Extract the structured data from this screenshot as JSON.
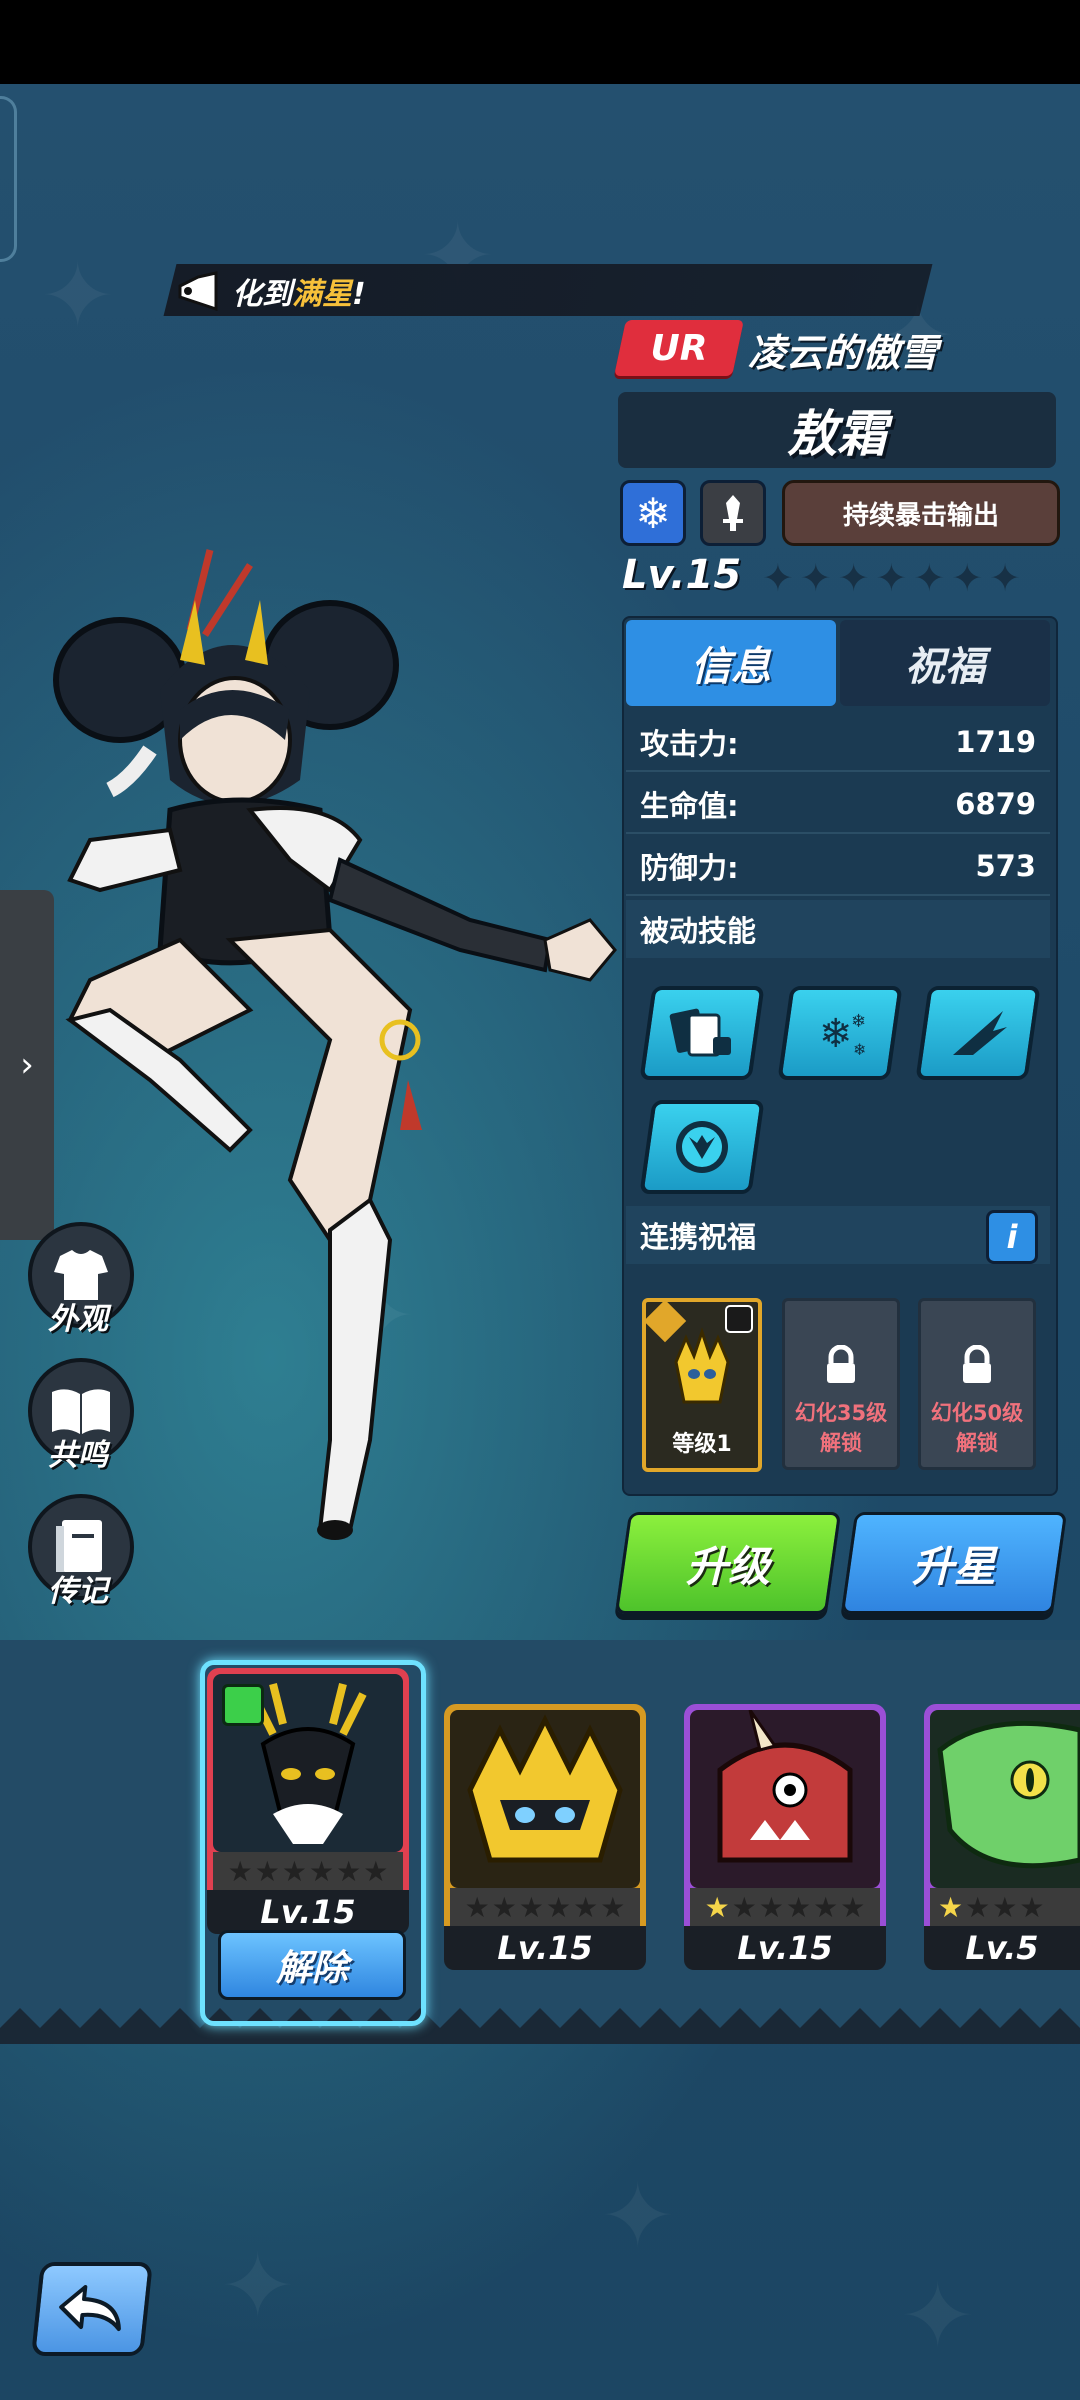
{
  "announcement": {
    "prefix": "化到",
    "highlight": "满星",
    "suffix": "!"
  },
  "character": {
    "rarity": "UR",
    "title": "凌云的傲雪",
    "name": "敖霜",
    "element_icon": "snowflake-icon",
    "role_icon": "sword-icon",
    "role_tag": "持续暴击输出",
    "level": "Lv.15",
    "stars": 0,
    "max_stars": 7
  },
  "tabs": [
    {
      "label": "信息",
      "active": true
    },
    {
      "label": "祝福",
      "active": false
    }
  ],
  "stats": [
    {
      "label": "攻击力:",
      "value": "1719"
    },
    {
      "label": "生命值:",
      "value": "6879"
    },
    {
      "label": "防御力:",
      "value": "573"
    }
  ],
  "passive": {
    "title": "被动技能",
    "skills": [
      "cards-dice-icon",
      "snowflakes-icon",
      "wing-icon",
      "dragon-emblem-icon"
    ]
  },
  "bond": {
    "title": "连携祝福",
    "info_label": "i",
    "cards": [
      {
        "level_label": "等级1",
        "locked": false
      },
      {
        "lock_line1": "幻化35级",
        "lock_line2": "解锁",
        "locked": true
      },
      {
        "lock_line1": "幻化50级",
        "lock_line2": "解锁",
        "locked": true
      }
    ]
  },
  "buttons": {
    "upgrade": "升级",
    "star_up": "升星",
    "release": "解除"
  },
  "side_menu": [
    {
      "label": "外观",
      "icon": "shirt-icon"
    },
    {
      "label": "共鸣",
      "icon": "book-icon"
    },
    {
      "label": "传记",
      "icon": "journal-icon"
    }
  ],
  "roster": [
    {
      "level": "Lv.15",
      "stars_lit": 0,
      "frame": "#e04050",
      "selected": true
    },
    {
      "level": "Lv.15",
      "stars_lit": 0,
      "frame": "#d69a22",
      "selected": false
    },
    {
      "level": "Lv.15",
      "stars_lit": 1,
      "frame": "#9b4fd6",
      "selected": false
    },
    {
      "level": "Lv.5",
      "stars_lit": 1,
      "frame": "#9b4fd6",
      "selected": false
    }
  ],
  "colors": {
    "accent_blue": "#2e8fe4",
    "accent_green": "#6ad234",
    "rarity_red": "#e02e3d",
    "highlight_gold": "#f7c13a"
  }
}
